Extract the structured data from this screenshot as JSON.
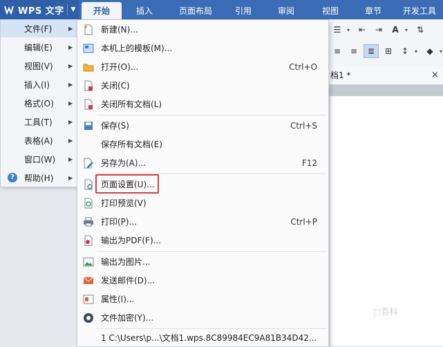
{
  "app": {
    "title": "WPS 文字",
    "brand_color": "#3a6db6"
  },
  "tabs": [
    {
      "label": "开始",
      "active": true
    },
    {
      "label": "插入"
    },
    {
      "label": "页面布局"
    },
    {
      "label": "引用"
    },
    {
      "label": "审阅"
    },
    {
      "label": "视图"
    },
    {
      "label": "章节"
    },
    {
      "label": "开发工具"
    }
  ],
  "document": {
    "tab_label": "档1 *",
    "close_glyph": "×"
  },
  "main_menu": {
    "items": [
      {
        "label": "文件(F)",
        "has_submenu": true,
        "active": true
      },
      {
        "label": "编辑(E)",
        "has_submenu": true
      },
      {
        "label": "视图(V)",
        "has_submenu": true
      },
      {
        "label": "插入(I)",
        "has_submenu": true
      },
      {
        "label": "格式(O)",
        "has_submenu": true
      },
      {
        "label": "工具(T)",
        "has_submenu": true
      },
      {
        "label": "表格(A)",
        "has_submenu": true
      },
      {
        "label": "窗口(W)",
        "has_submenu": true
      },
      {
        "label": "帮助(H)",
        "has_submenu": true,
        "icon": "help-icon"
      }
    ]
  },
  "file_menu": {
    "items": [
      {
        "label": "新建(N)...",
        "icon": "new-document-icon",
        "shortcut": ""
      },
      {
        "label": "本机上的模板(M)...",
        "icon": "template-icon",
        "shortcut": ""
      },
      {
        "label": "打开(O)...",
        "icon": "open-folder-icon",
        "shortcut": "Ctrl+O"
      },
      {
        "label": "关闭(C)",
        "icon": "close-document-icon",
        "shortcut": ""
      },
      {
        "label": "关闭所有文档(L)",
        "icon": "close-all-documents-icon",
        "shortcut": ""
      },
      {
        "label": "保存(S)",
        "icon": "save-icon",
        "shortcut": "Ctrl+S"
      },
      {
        "label": "保存所有文档(E)",
        "icon": "",
        "shortcut": ""
      },
      {
        "label": "另存为(A)...",
        "icon": "save-as-icon",
        "shortcut": "F12"
      },
      {
        "label": "页面设置(U)...",
        "icon": "page-setup-icon",
        "shortcut": "",
        "highlighted": true
      },
      {
        "label": "打印预览(V)",
        "icon": "print-preview-icon",
        "shortcut": ""
      },
      {
        "label": "打印(P)...",
        "icon": "printer-icon",
        "shortcut": "Ctrl+P"
      },
      {
        "label": "输出为PDF(F)...",
        "icon": "pdf-icon",
        "shortcut": ""
      },
      {
        "label": "输出为图片...",
        "icon": "image-export-icon",
        "shortcut": ""
      },
      {
        "label": "发送邮件(D)...",
        "icon": "mail-icon",
        "shortcut": ""
      },
      {
        "label": "属性(I)...",
        "icon": "properties-icon",
        "shortcut": ""
      },
      {
        "label": "文件加密(Y)...",
        "icon": "encrypt-icon",
        "shortcut": ""
      },
      {
        "label": "1 C:\\Users\\p...\\文档1.wps.8C89984EC9A81B34D42...",
        "icon": "",
        "shortcut": ""
      }
    ],
    "highlight_color": "#e0393e"
  },
  "watermark": "□百科"
}
